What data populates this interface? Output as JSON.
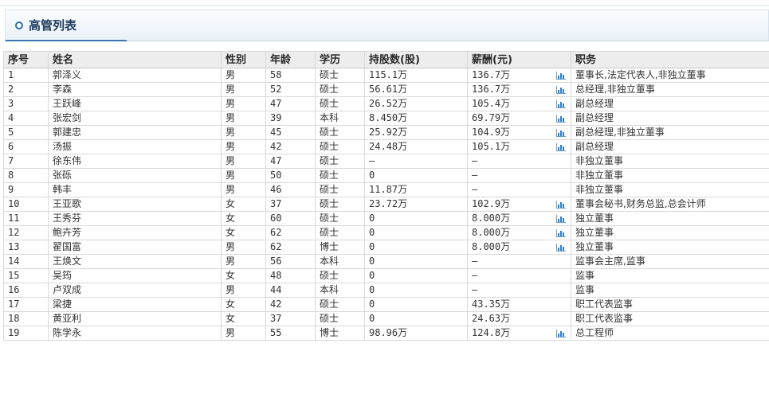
{
  "panel": {
    "title": "高管列表"
  },
  "columns": {
    "no": "序号",
    "name": "姓名",
    "gender": "性别",
    "age": "年龄",
    "education": "学历",
    "shares": "持股数(股)",
    "salary": "薪酬(元)",
    "position": "职务"
  },
  "rows": [
    {
      "no": "1",
      "name": "郭泽义",
      "gender": "男",
      "age": "58",
      "education": "硕士",
      "shares": "115.1万",
      "salary": "136.7万",
      "chart": true,
      "position": "董事长,法定代表人,非独立董事"
    },
    {
      "no": "2",
      "name": "李森",
      "gender": "男",
      "age": "52",
      "education": "硕士",
      "shares": "56.61万",
      "salary": "136.7万",
      "chart": true,
      "position": "总经理,非独立董事"
    },
    {
      "no": "3",
      "name": "王跃峰",
      "gender": "男",
      "age": "47",
      "education": "硕士",
      "shares": "26.52万",
      "salary": "105.4万",
      "chart": true,
      "position": "副总经理"
    },
    {
      "no": "4",
      "name": "张宏剑",
      "gender": "男",
      "age": "39",
      "education": "本科",
      "shares": "8.450万",
      "salary": "69.79万",
      "chart": true,
      "position": "副总经理"
    },
    {
      "no": "5",
      "name": "郭建忠",
      "gender": "男",
      "age": "45",
      "education": "硕士",
      "shares": "25.92万",
      "salary": "104.9万",
      "chart": true,
      "position": "副总经理,非独立董事"
    },
    {
      "no": "6",
      "name": "汤振",
      "gender": "男",
      "age": "42",
      "education": "硕士",
      "shares": "24.48万",
      "salary": "105.1万",
      "chart": true,
      "position": "副总经理"
    },
    {
      "no": "7",
      "name": "徐东伟",
      "gender": "男",
      "age": "47",
      "education": "硕士",
      "shares": "—",
      "salary": "—",
      "chart": false,
      "position": "非独立董事"
    },
    {
      "no": "8",
      "name": "张砾",
      "gender": "男",
      "age": "50",
      "education": "硕士",
      "shares": "0",
      "salary": "—",
      "chart": false,
      "position": "非独立董事"
    },
    {
      "no": "9",
      "name": "韩丰",
      "gender": "男",
      "age": "46",
      "education": "硕士",
      "shares": "11.87万",
      "salary": "—",
      "chart": false,
      "position": "非独立董事"
    },
    {
      "no": "10",
      "name": "王亚歌",
      "gender": "女",
      "age": "37",
      "education": "硕士",
      "shares": "23.72万",
      "salary": "102.9万",
      "chart": true,
      "position": "董事会秘书,财务总监,总会计师"
    },
    {
      "no": "11",
      "name": "王秀芬",
      "gender": "女",
      "age": "60",
      "education": "硕士",
      "shares": "0",
      "salary": "8.000万",
      "chart": true,
      "position": "独立董事"
    },
    {
      "no": "12",
      "name": "鲍卉芳",
      "gender": "女",
      "age": "62",
      "education": "硕士",
      "shares": "0",
      "salary": "8.000万",
      "chart": true,
      "position": "独立董事"
    },
    {
      "no": "13",
      "name": "翟国富",
      "gender": "男",
      "age": "62",
      "education": "博士",
      "shares": "0",
      "salary": "8.000万",
      "chart": true,
      "position": "独立董事"
    },
    {
      "no": "14",
      "name": "王焕文",
      "gender": "男",
      "age": "56",
      "education": "本科",
      "shares": "0",
      "salary": "—",
      "chart": false,
      "position": "监事会主席,监事"
    },
    {
      "no": "15",
      "name": "吴筠",
      "gender": "女",
      "age": "48",
      "education": "硕士",
      "shares": "0",
      "salary": "—",
      "chart": false,
      "position": "监事"
    },
    {
      "no": "16",
      "name": "卢双成",
      "gender": "男",
      "age": "44",
      "education": "本科",
      "shares": "0",
      "salary": "—",
      "chart": false,
      "position": "监事"
    },
    {
      "no": "17",
      "name": "梁捷",
      "gender": "女",
      "age": "42",
      "education": "硕士",
      "shares": "0",
      "salary": "43.35万",
      "chart": false,
      "position": "职工代表监事"
    },
    {
      "no": "18",
      "name": "黄亚利",
      "gender": "女",
      "age": "37",
      "education": "硕士",
      "shares": "0",
      "salary": "24.63万",
      "chart": false,
      "position": "职工代表监事"
    },
    {
      "no": "19",
      "name": "陈学永",
      "gender": "男",
      "age": "55",
      "education": "博士",
      "shares": "98.96万",
      "salary": "124.8万",
      "chart": true,
      "position": "总工程师"
    }
  ],
  "colors": {
    "accent": "#3b78b2",
    "icon": "#2e7fc4",
    "header_bg": "#ededed"
  },
  "icons": {
    "panel": "circle-icon",
    "salary_chart": "bar-chart-icon"
  }
}
